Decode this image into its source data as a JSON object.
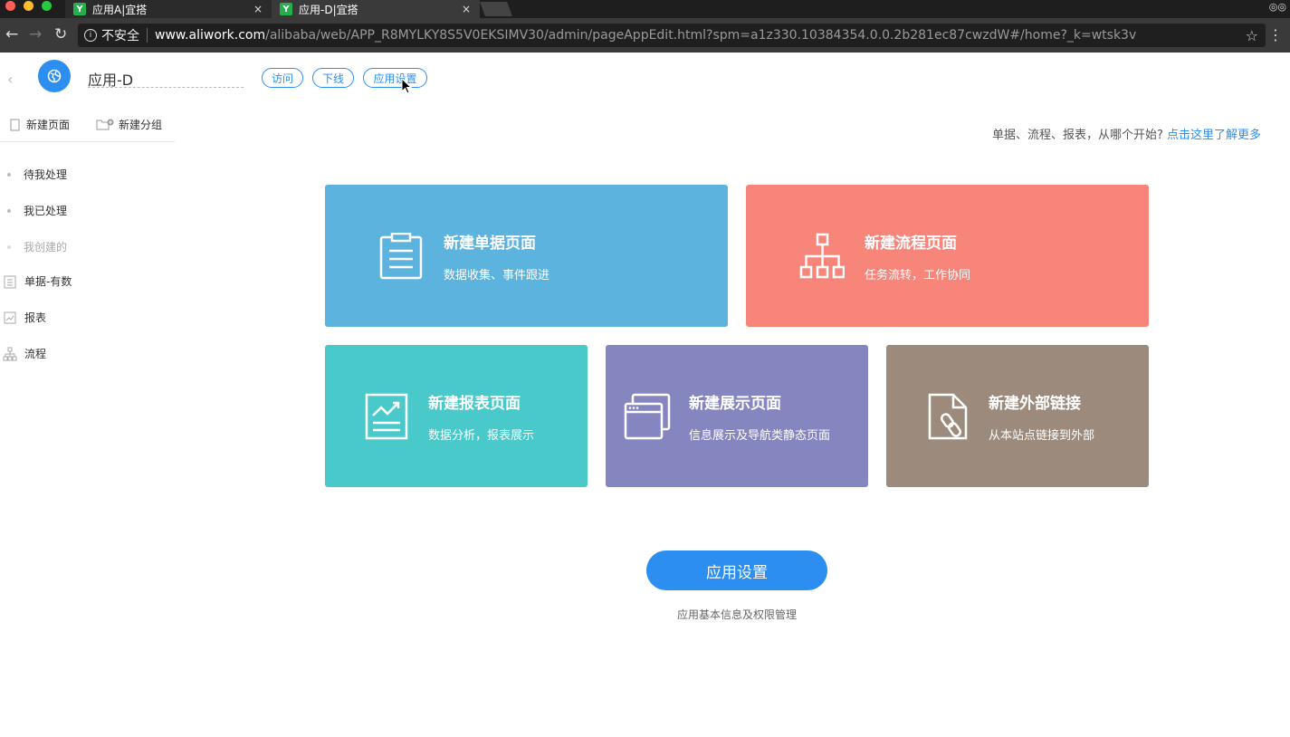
{
  "browser": {
    "tabs": [
      {
        "title": "应用A|宜搭",
        "active": false
      },
      {
        "title": "应用-D|宜搭",
        "active": true
      }
    ],
    "close_glyph": "×",
    "insecure_label": "不安全",
    "url_domain": "www.aliwork.com",
    "url_path": "/alibaba/web/APP_R8MYLKY8S5V0EKSIMV30/admin/pageAppEdit.html?spm=a1z330.10384354.0.0.2b281ec87cwzdW#/home?_k=wtsk3v"
  },
  "header": {
    "app_name": "应用-D",
    "buttons": {
      "visit": "访问",
      "offline": "下线",
      "settings": "应用设置"
    }
  },
  "sidebar": {
    "new_page": "新建页面",
    "new_group": "新建分组",
    "items": [
      {
        "label": "待我处理",
        "icon": "dot"
      },
      {
        "label": "我已处理",
        "icon": "dot"
      },
      {
        "label": "我创建的",
        "icon": "dot",
        "muted": true
      },
      {
        "label": "单据-有数",
        "icon": "form-icon"
      },
      {
        "label": "报表",
        "icon": "report-icon"
      },
      {
        "label": "流程",
        "icon": "flow-icon"
      }
    ]
  },
  "hint": {
    "text": "单据、流程、报表，从哪个开始?",
    "link": "点击这里了解更多"
  },
  "cards": {
    "form": {
      "title": "新建单据页面",
      "subtitle": "数据收集、事件跟进",
      "color": "#5bb3de"
    },
    "flow": {
      "title": "新建流程页面",
      "subtitle": "任务流转，工作协同",
      "color": "#f7857a"
    },
    "report": {
      "title": "新建报表页面",
      "subtitle": "数据分析，报表展示",
      "color": "#4ac9ca"
    },
    "display": {
      "title": "新建展示页面",
      "subtitle": "信息展示及导航类静态页面",
      "color": "#8586c0"
    },
    "link": {
      "title": "新建外部链接",
      "subtitle": "从本站点链接到外部",
      "color": "#9c8b7c"
    }
  },
  "footer": {
    "button": "应用设置",
    "caption": "应用基本信息及权限管理",
    "accent": "#2b8ef0"
  }
}
